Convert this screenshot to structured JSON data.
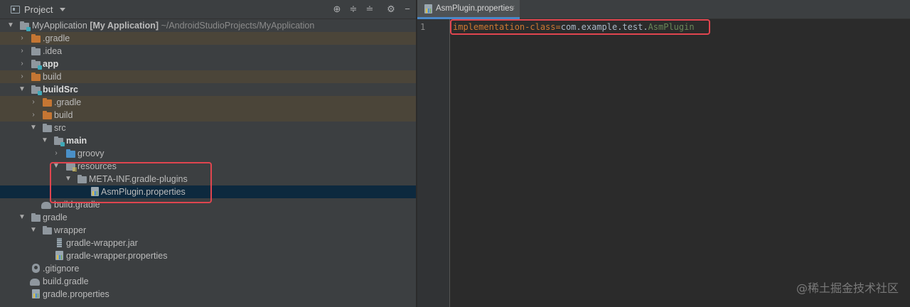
{
  "project_panel": {
    "title": "Project",
    "toolbar_icons": [
      "locate-icon",
      "expand-all-icon",
      "collapse-all-icon",
      "gear-icon",
      "minimize-icon"
    ]
  },
  "tree": {
    "root": {
      "name": "MyApplication",
      "module": "[My Application]",
      "path": "~/AndroidStudioProjects/MyApplication"
    },
    "items": [
      {
        "label": ".gradle"
      },
      {
        "label": ".idea"
      },
      {
        "label": "app"
      },
      {
        "label": "build"
      },
      {
        "label": "buildSrc"
      },
      {
        "label": ".gradle"
      },
      {
        "label": "build"
      },
      {
        "label": "src"
      },
      {
        "label": "main"
      },
      {
        "label": "groovy"
      },
      {
        "label": "resources"
      },
      {
        "label": "META-INF.gradle-plugins"
      },
      {
        "label": "AsmPlugin.properties"
      },
      {
        "label": "build.gradle"
      },
      {
        "label": "gradle"
      },
      {
        "label": "wrapper"
      },
      {
        "label": "gradle-wrapper.jar"
      },
      {
        "label": "gradle-wrapper.properties"
      },
      {
        "label": ".gitignore"
      },
      {
        "label": "build.gradle"
      },
      {
        "label": "gradle.properties"
      }
    ]
  },
  "editor": {
    "tab_label": "AsmPlugin.properties",
    "tab_close": "×",
    "line_number": "1",
    "code": {
      "key": "implementation-class",
      "eq": "=",
      "package": "com.example.test.",
      "class": "AsmPlugin"
    }
  },
  "watermark": "@稀土掘金技术社区",
  "colors": {
    "selection": "#0d293e",
    "excluded_row": "#4b4539",
    "highlight_box": "#e0454f",
    "orange_folder": "#c57633"
  }
}
